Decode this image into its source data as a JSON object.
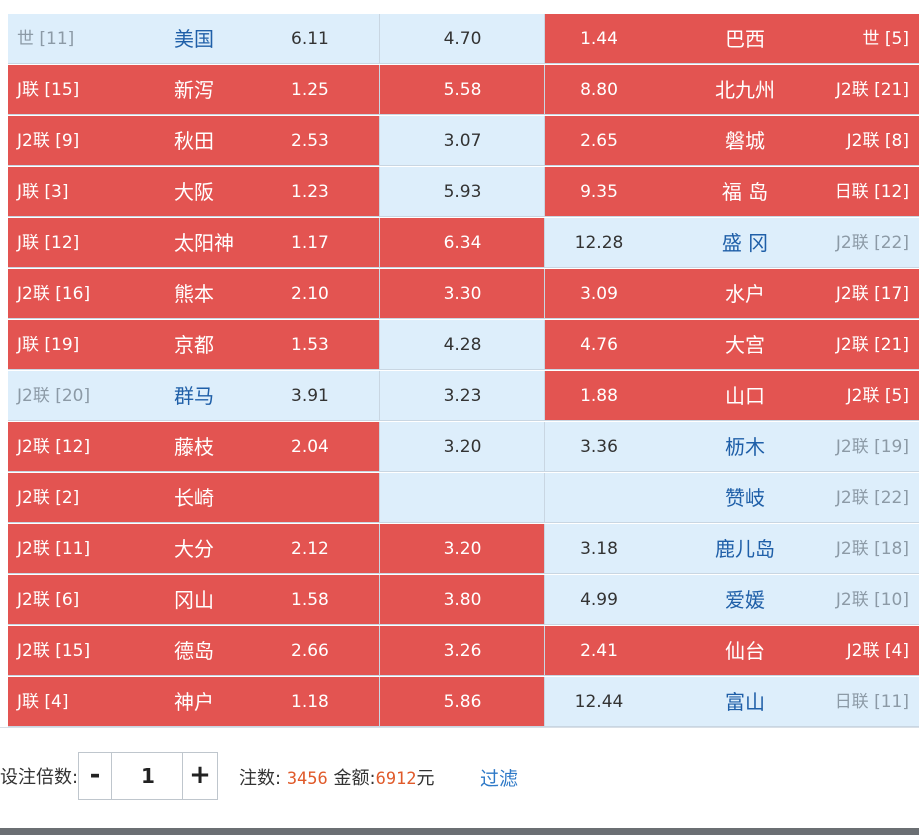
{
  "rows": [
    {
      "home_league": "世 [11]",
      "home_team": "美国",
      "home_odds": "6.11",
      "draw_odds": "4.70",
      "away_odds": "1.44",
      "away_team": "巴西",
      "away_league": "世 [5]",
      "sel": [
        false,
        false,
        true
      ]
    },
    {
      "home_league": "J联 [15]",
      "home_team": "新泻",
      "home_odds": "1.25",
      "draw_odds": "5.58",
      "away_odds": "8.80",
      "away_team": "北九州",
      "away_league": "J2联 [21]",
      "sel": [
        true,
        true,
        true
      ]
    },
    {
      "home_league": "J2联 [9]",
      "home_team": "秋田",
      "home_odds": "2.53",
      "draw_odds": "3.07",
      "away_odds": "2.65",
      "away_team": "磐城",
      "away_league": "J2联 [8]",
      "sel": [
        true,
        false,
        true
      ]
    },
    {
      "home_league": "J联 [3]",
      "home_team": "大阪",
      "home_odds": "1.23",
      "draw_odds": "5.93",
      "away_odds": "9.35",
      "away_team": "福 岛",
      "away_league": "日联 [12]",
      "sel": [
        true,
        false,
        true
      ]
    },
    {
      "home_league": "J联 [12]",
      "home_team": "太阳神",
      "home_odds": "1.17",
      "draw_odds": "6.34",
      "away_odds": "12.28",
      "away_team": "盛 冈",
      "away_league": "J2联 [22]",
      "sel": [
        true,
        true,
        false
      ]
    },
    {
      "home_league": "J2联 [16]",
      "home_team": "熊本",
      "home_odds": "2.10",
      "draw_odds": "3.30",
      "away_odds": "3.09",
      "away_team": "水户",
      "away_league": "J2联 [17]",
      "sel": [
        true,
        true,
        true
      ]
    },
    {
      "home_league": "J联 [19]",
      "home_team": "京都",
      "home_odds": "1.53",
      "draw_odds": "4.28",
      "away_odds": "4.76",
      "away_team": "大宫",
      "away_league": "J2联 [21]",
      "sel": [
        true,
        false,
        true
      ]
    },
    {
      "home_league": "J2联 [20]",
      "home_team": "群马",
      "home_odds": "3.91",
      "draw_odds": "3.23",
      "away_odds": "1.88",
      "away_team": "山口",
      "away_league": "J2联 [5]",
      "sel": [
        false,
        false,
        true
      ]
    },
    {
      "home_league": "J2联 [12]",
      "home_team": "藤枝",
      "home_odds": "2.04",
      "draw_odds": "3.20",
      "away_odds": "3.36",
      "away_team": "枥木",
      "away_league": "J2联 [19]",
      "sel": [
        true,
        false,
        false
      ]
    },
    {
      "home_league": "J2联 [2]",
      "home_team": "长崎",
      "home_odds": "",
      "draw_odds": "",
      "away_odds": "",
      "away_team": "赞岐",
      "away_league": "J2联 [22]",
      "sel": [
        true,
        false,
        false
      ]
    },
    {
      "home_league": "J2联 [11]",
      "home_team": "大分",
      "home_odds": "2.12",
      "draw_odds": "3.20",
      "away_odds": "3.18",
      "away_team": "鹿儿岛",
      "away_league": "J2联 [18]",
      "sel": [
        true,
        true,
        false
      ]
    },
    {
      "home_league": "J2联 [6]",
      "home_team": "冈山",
      "home_odds": "1.58",
      "draw_odds": "3.80",
      "away_odds": "4.99",
      "away_team": "爱媛",
      "away_league": "J2联 [10]",
      "sel": [
        true,
        true,
        false
      ]
    },
    {
      "home_league": "J2联 [15]",
      "home_team": "德岛",
      "home_odds": "2.66",
      "draw_odds": "3.26",
      "away_odds": "2.41",
      "away_team": "仙台",
      "away_league": "J2联 [4]",
      "sel": [
        true,
        true,
        true
      ]
    },
    {
      "home_league": "J联 [4]",
      "home_team": "神户",
      "home_odds": "1.18",
      "draw_odds": "5.86",
      "away_odds": "12.44",
      "away_team": "富山",
      "away_league": "日联 [11]",
      "sel": [
        true,
        true,
        false
      ]
    }
  ],
  "footer": {
    "multiplier_label": "设注倍数:",
    "minus": "-",
    "plus": "+",
    "multiplier_value": "1",
    "bets_label": "注数:",
    "bets_value": "3456",
    "amount_label": "金额:",
    "amount_value": "6912",
    "amount_unit": "元",
    "filter_label": "过滤"
  },
  "colors": {
    "selected": "#e35451",
    "unselected": "#ddeefb",
    "number": "#e05a2a",
    "link": "#2e79c7"
  }
}
